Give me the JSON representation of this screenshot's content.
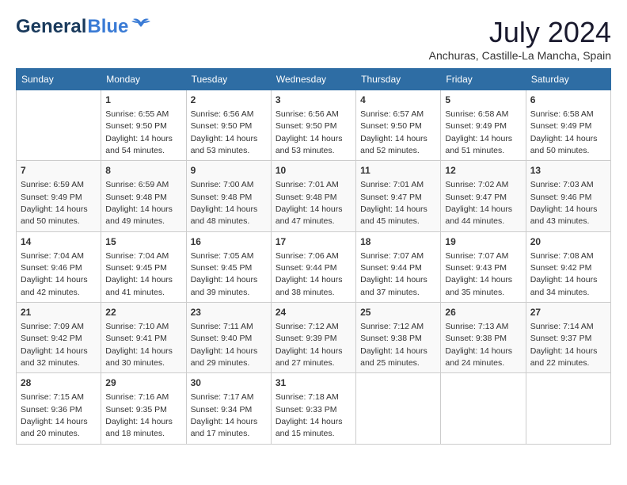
{
  "header": {
    "logo_general": "General",
    "logo_blue": "Blue",
    "month_year": "July 2024",
    "location": "Anchuras, Castille-La Mancha, Spain"
  },
  "weekdays": [
    "Sunday",
    "Monday",
    "Tuesday",
    "Wednesday",
    "Thursday",
    "Friday",
    "Saturday"
  ],
  "weeks": [
    [
      {
        "day": "",
        "sunrise": "",
        "sunset": "",
        "daylight": ""
      },
      {
        "day": "1",
        "sunrise": "Sunrise: 6:55 AM",
        "sunset": "Sunset: 9:50 PM",
        "daylight": "Daylight: 14 hours and 54 minutes."
      },
      {
        "day": "2",
        "sunrise": "Sunrise: 6:56 AM",
        "sunset": "Sunset: 9:50 PM",
        "daylight": "Daylight: 14 hours and 53 minutes."
      },
      {
        "day": "3",
        "sunrise": "Sunrise: 6:56 AM",
        "sunset": "Sunset: 9:50 PM",
        "daylight": "Daylight: 14 hours and 53 minutes."
      },
      {
        "day": "4",
        "sunrise": "Sunrise: 6:57 AM",
        "sunset": "Sunset: 9:50 PM",
        "daylight": "Daylight: 14 hours and 52 minutes."
      },
      {
        "day": "5",
        "sunrise": "Sunrise: 6:58 AM",
        "sunset": "Sunset: 9:49 PM",
        "daylight": "Daylight: 14 hours and 51 minutes."
      },
      {
        "day": "6",
        "sunrise": "Sunrise: 6:58 AM",
        "sunset": "Sunset: 9:49 PM",
        "daylight": "Daylight: 14 hours and 50 minutes."
      }
    ],
    [
      {
        "day": "7",
        "sunrise": "Sunrise: 6:59 AM",
        "sunset": "Sunset: 9:49 PM",
        "daylight": "Daylight: 14 hours and 50 minutes."
      },
      {
        "day": "8",
        "sunrise": "Sunrise: 6:59 AM",
        "sunset": "Sunset: 9:48 PM",
        "daylight": "Daylight: 14 hours and 49 minutes."
      },
      {
        "day": "9",
        "sunrise": "Sunrise: 7:00 AM",
        "sunset": "Sunset: 9:48 PM",
        "daylight": "Daylight: 14 hours and 48 minutes."
      },
      {
        "day": "10",
        "sunrise": "Sunrise: 7:01 AM",
        "sunset": "Sunset: 9:48 PM",
        "daylight": "Daylight: 14 hours and 47 minutes."
      },
      {
        "day": "11",
        "sunrise": "Sunrise: 7:01 AM",
        "sunset": "Sunset: 9:47 PM",
        "daylight": "Daylight: 14 hours and 45 minutes."
      },
      {
        "day": "12",
        "sunrise": "Sunrise: 7:02 AM",
        "sunset": "Sunset: 9:47 PM",
        "daylight": "Daylight: 14 hours and 44 minutes."
      },
      {
        "day": "13",
        "sunrise": "Sunrise: 7:03 AM",
        "sunset": "Sunset: 9:46 PM",
        "daylight": "Daylight: 14 hours and 43 minutes."
      }
    ],
    [
      {
        "day": "14",
        "sunrise": "Sunrise: 7:04 AM",
        "sunset": "Sunset: 9:46 PM",
        "daylight": "Daylight: 14 hours and 42 minutes."
      },
      {
        "day": "15",
        "sunrise": "Sunrise: 7:04 AM",
        "sunset": "Sunset: 9:45 PM",
        "daylight": "Daylight: 14 hours and 41 minutes."
      },
      {
        "day": "16",
        "sunrise": "Sunrise: 7:05 AM",
        "sunset": "Sunset: 9:45 PM",
        "daylight": "Daylight: 14 hours and 39 minutes."
      },
      {
        "day": "17",
        "sunrise": "Sunrise: 7:06 AM",
        "sunset": "Sunset: 9:44 PM",
        "daylight": "Daylight: 14 hours and 38 minutes."
      },
      {
        "day": "18",
        "sunrise": "Sunrise: 7:07 AM",
        "sunset": "Sunset: 9:44 PM",
        "daylight": "Daylight: 14 hours and 37 minutes."
      },
      {
        "day": "19",
        "sunrise": "Sunrise: 7:07 AM",
        "sunset": "Sunset: 9:43 PM",
        "daylight": "Daylight: 14 hours and 35 minutes."
      },
      {
        "day": "20",
        "sunrise": "Sunrise: 7:08 AM",
        "sunset": "Sunset: 9:42 PM",
        "daylight": "Daylight: 14 hours and 34 minutes."
      }
    ],
    [
      {
        "day": "21",
        "sunrise": "Sunrise: 7:09 AM",
        "sunset": "Sunset: 9:42 PM",
        "daylight": "Daylight: 14 hours and 32 minutes."
      },
      {
        "day": "22",
        "sunrise": "Sunrise: 7:10 AM",
        "sunset": "Sunset: 9:41 PM",
        "daylight": "Daylight: 14 hours and 30 minutes."
      },
      {
        "day": "23",
        "sunrise": "Sunrise: 7:11 AM",
        "sunset": "Sunset: 9:40 PM",
        "daylight": "Daylight: 14 hours and 29 minutes."
      },
      {
        "day": "24",
        "sunrise": "Sunrise: 7:12 AM",
        "sunset": "Sunset: 9:39 PM",
        "daylight": "Daylight: 14 hours and 27 minutes."
      },
      {
        "day": "25",
        "sunrise": "Sunrise: 7:12 AM",
        "sunset": "Sunset: 9:38 PM",
        "daylight": "Daylight: 14 hours and 25 minutes."
      },
      {
        "day": "26",
        "sunrise": "Sunrise: 7:13 AM",
        "sunset": "Sunset: 9:38 PM",
        "daylight": "Daylight: 14 hours and 24 minutes."
      },
      {
        "day": "27",
        "sunrise": "Sunrise: 7:14 AM",
        "sunset": "Sunset: 9:37 PM",
        "daylight": "Daylight: 14 hours and 22 minutes."
      }
    ],
    [
      {
        "day": "28",
        "sunrise": "Sunrise: 7:15 AM",
        "sunset": "Sunset: 9:36 PM",
        "daylight": "Daylight: 14 hours and 20 minutes."
      },
      {
        "day": "29",
        "sunrise": "Sunrise: 7:16 AM",
        "sunset": "Sunset: 9:35 PM",
        "daylight": "Daylight: 14 hours and 18 minutes."
      },
      {
        "day": "30",
        "sunrise": "Sunrise: 7:17 AM",
        "sunset": "Sunset: 9:34 PM",
        "daylight": "Daylight: 14 hours and 17 minutes."
      },
      {
        "day": "31",
        "sunrise": "Sunrise: 7:18 AM",
        "sunset": "Sunset: 9:33 PM",
        "daylight": "Daylight: 14 hours and 15 minutes."
      },
      {
        "day": "",
        "sunrise": "",
        "sunset": "",
        "daylight": ""
      },
      {
        "day": "",
        "sunrise": "",
        "sunset": "",
        "daylight": ""
      },
      {
        "day": "",
        "sunrise": "",
        "sunset": "",
        "daylight": ""
      }
    ]
  ]
}
